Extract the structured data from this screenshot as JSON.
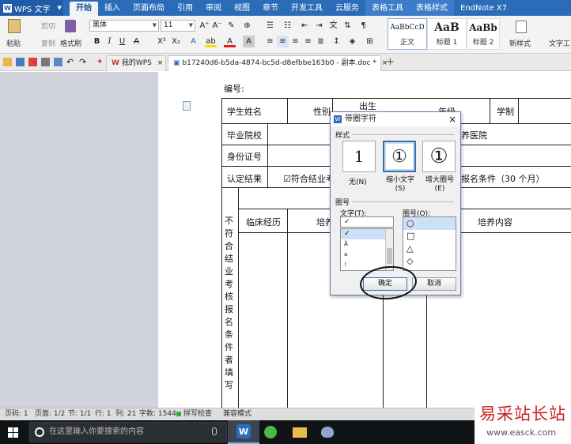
{
  "app": {
    "name": "WPS 文字",
    "logo_letter": "W"
  },
  "ribbon_tabs": [
    "开始",
    "插入",
    "页面布局",
    "引用",
    "审阅",
    "视图",
    "章节",
    "开发工具",
    "云服务",
    "表格工具",
    "表格样式",
    "EndNote X7"
  ],
  "active_tab": "开始",
  "ribbon": {
    "clipboard": {
      "paste": "粘贴",
      "cut": "剪切",
      "copy": "复制",
      "format_painter": "格式刷"
    },
    "font_name": "黑体",
    "font_size": "11",
    "styles": [
      {
        "sample": "AaBbCcD",
        "name": "正文"
      },
      {
        "sample": "AaB",
        "name": "标题 1"
      },
      {
        "sample": "AaBb",
        "name": "标题 2"
      }
    ],
    "new_style": "新样式",
    "text_tools": "文字工"
  },
  "doc_tabs": [
    {
      "label": "我的WPS"
    },
    {
      "label": "b17240d6-b5da-4874-bc5d-d8efbbe163b0 - 副本.doc *"
    }
  ],
  "document": {
    "number_label": "编号:",
    "cells": {
      "student_name": "学生姓名",
      "gender": "性别",
      "birth_1": "出生",
      "birth_2": "日期",
      "age": "年级",
      "academic": "学制",
      "college": "毕业院校",
      "hospital": "培养医院",
      "id_number": "身份证号",
      "result": "认定结果",
      "checkbox_text": "☑符合结业考",
      "condition": "报名条件（30 个月）",
      "clinical": "临床经历",
      "train": "培养",
      "train_content": "培养内容",
      "vertical": "不符合结业考核报名条件者填写"
    }
  },
  "dialog": {
    "title": "带圈字符",
    "close": "×",
    "style_label": "样式",
    "styles": [
      {
        "glyph": "1",
        "label": "无(N)"
      },
      {
        "glyph": "①",
        "label": "缩小文字(S)"
      },
      {
        "glyph": "①",
        "label": "增大圈号(E)"
      }
    ],
    "circle_group_label": "圈号",
    "text_label": "文字(T):",
    "text_value": "✓",
    "text_list": [
      "✓",
      "Å",
      "a",
      "!"
    ],
    "circle_label": "圈号(O):",
    "circle_list": [
      "○",
      "□",
      "△",
      "◇"
    ],
    "ok": "确定",
    "cancel": "取消"
  },
  "status": {
    "page_num": "页码: 1",
    "pages": "页面: 1/2",
    "section": "节: 1/1",
    "row": "行: 1",
    "col": "列: 21",
    "words": "字数: 1544",
    "spell": "拼写检查",
    "compat": "兼容模式"
  },
  "taskbar": {
    "search_placeholder": "在这里输入你要搜索的内容"
  },
  "watermark": {
    "cn": "易采站长站",
    "url": "www.easck.com"
  }
}
